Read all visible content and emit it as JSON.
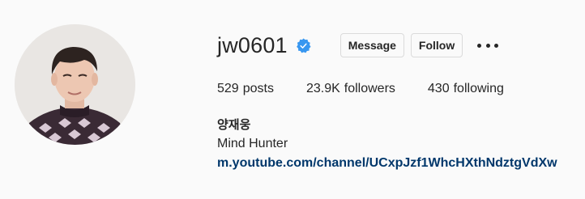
{
  "profile": {
    "username": "jw0601",
    "verified": true,
    "buttons": {
      "message": "Message",
      "follow": "Follow"
    },
    "more_icon": "more-horizontal-icon",
    "stats": {
      "posts_count": "529",
      "posts_label": "posts",
      "followers_count": "23.9K",
      "followers_label": "followers",
      "following_count": "430",
      "following_label": "following"
    },
    "bio": {
      "name": "양재웅",
      "description": "Mind Hunter",
      "link": "m.youtube.com/channel/UCxpJzf1WhcHXthNdztgVdXw"
    }
  },
  "colors": {
    "background": "#fafafa",
    "text": "#262626",
    "link": "#00376b",
    "verified": "#3897f0",
    "border": "#dbdbdb"
  }
}
